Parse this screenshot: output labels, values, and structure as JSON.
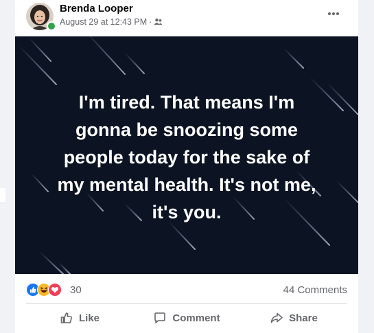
{
  "post": {
    "author": "Brenda Looper",
    "timestamp": "August 29 at 12:43 PM",
    "separator": "·",
    "audience_icon": "friends-icon",
    "more_icon": "more-options-icon"
  },
  "content": {
    "text": "I'm tired. That means I'm\ngonna be snoozing some\npeople today for the sake of\nmy mental health. It's not me,\nit's you.",
    "background_color": "#0c1424",
    "text_color": "#ffffff"
  },
  "engagement": {
    "reactions": [
      "like",
      "haha",
      "love"
    ],
    "reaction_count": "30",
    "comments": "44 Comments"
  },
  "actions": {
    "like": "Like",
    "comment": "Comment",
    "share": "Share"
  },
  "colors": {
    "like_blue": "#1877f2",
    "love_red": "#f33e58",
    "haha_yellow": "#f7b928",
    "online_green": "#31a24c",
    "secondary_text": "#65676b"
  }
}
